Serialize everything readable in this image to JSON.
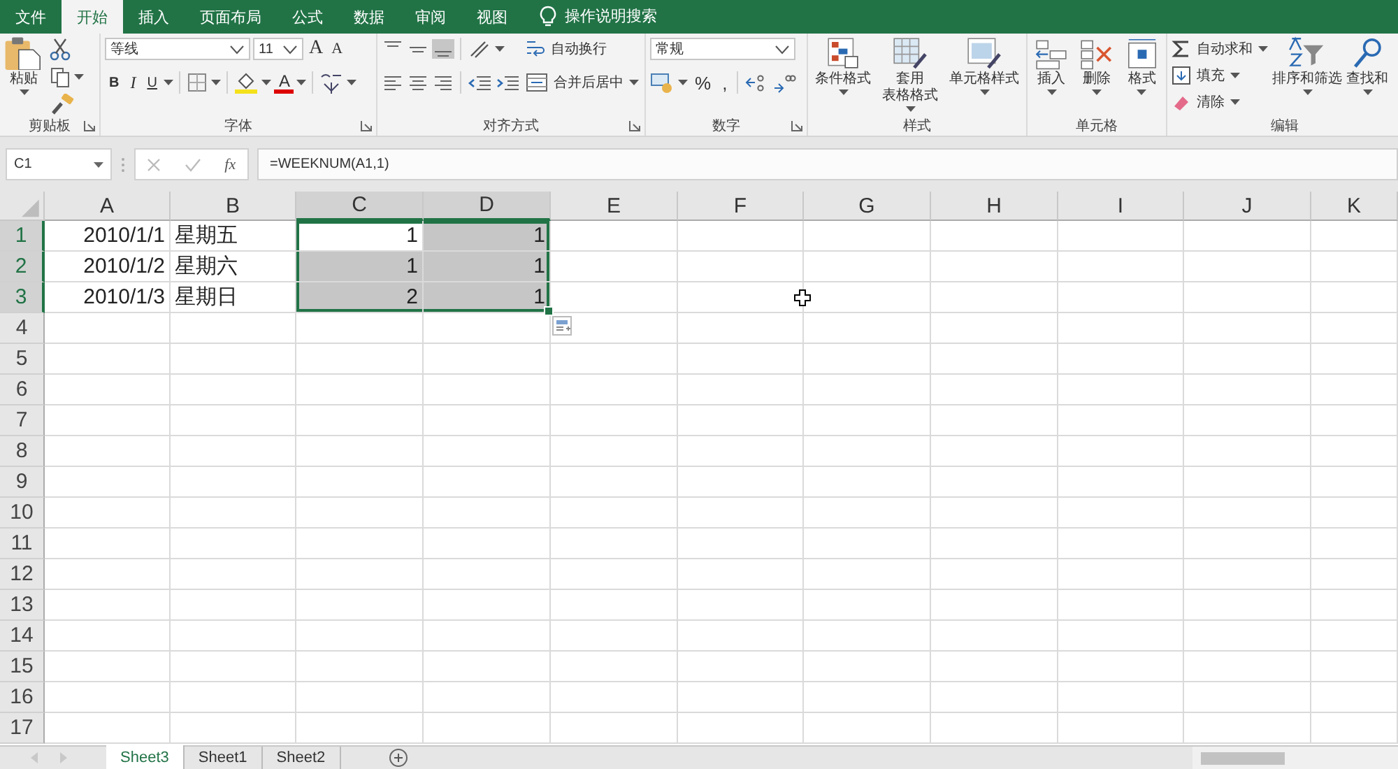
{
  "menu_tabs": [
    {
      "label": "文件",
      "selected": false
    },
    {
      "label": "开始",
      "selected": true
    },
    {
      "label": "插入",
      "selected": false
    },
    {
      "label": "页面布局",
      "selected": false
    },
    {
      "label": "公式",
      "selected": false
    },
    {
      "label": "数据",
      "selected": false
    },
    {
      "label": "审阅",
      "selected": false
    },
    {
      "label": "视图",
      "selected": false
    }
  ],
  "tell_me": {
    "placeholder": "操作说明搜索"
  },
  "ribbon_groups": [
    {
      "label": "剪贴板",
      "launcher": true,
      "items": [
        {
          "kind": "large",
          "label": "粘贴",
          "caret": true
        },
        {
          "kind": "stack",
          "rows": [
            {
              "controls": [
                {
                  "kind": "icon"
                }
              ]
            },
            {
              "controls": [
                {
                  "kind": "icon"
                },
                {
                  "kind": "caret"
                }
              ]
            },
            {
              "controls": [
                {
                  "kind": "icon"
                }
              ]
            }
          ]
        }
      ]
    },
    {
      "label": "字体",
      "launcher": true,
      "items": [
        {
          "kind": "stack",
          "rows": [
            {
              "controls": [
                {
                  "kind": "dropdown",
                  "value": "等线"
                },
                {
                  "kind": "dropdown",
                  "value": "11"
                },
                {
                  "kind": "char",
                  "text": "A"
                },
                {
                  "kind": "char",
                  "text": "A"
                }
              ]
            },
            {
              "controls": [
                {
                  "kind": "char",
                  "text": "B"
                },
                {
                  "kind": "char",
                  "text": "I"
                },
                {
                  "kind": "char",
                  "text": "U"
                },
                {
                  "kind": "caret"
                },
                {
                  "kind": "sep"
                },
                {
                  "kind": "icon"
                },
                {
                  "kind": "caret"
                },
                {
                  "kind": "sep"
                },
                {
                  "kind": "icon"
                },
                {
                  "kind": "caret"
                },
                {
                  "kind": "char",
                  "text": "A"
                },
                {
                  "kind": "caret"
                },
                {
                  "kind": "sep"
                },
                {
                  "kind": "icon"
                },
                {
                  "kind": "caret"
                }
              ]
            }
          ]
        }
      ]
    },
    {
      "label": "对齐方式",
      "launcher": true,
      "items": [
        {
          "kind": "stack",
          "rows": [
            {
              "controls": [
                {
                  "kind": "icon",
                  "pressed": false
                },
                {
                  "kind": "icon",
                  "pressed": false
                },
                {
                  "kind": "icon",
                  "pressed": true
                },
                {
                  "kind": "sep"
                },
                {
                  "kind": "icon",
                  "pressed": false
                },
                {
                  "kind": "caret"
                }
              ]
            },
            {
              "controls": [
                {
                  "kind": "icon",
                  "pressed": false
                },
                {
                  "kind": "icon",
                  "pressed": false
                },
                {
                  "kind": "icon",
                  "pressed": false
                },
                {
                  "kind": "sep"
                },
                {
                  "kind": "icon",
                  "pressed": false
                },
                {
                  "kind": "icon",
                  "pressed": false
                }
              ]
            }
          ]
        },
        {
          "kind": "stack",
          "rows": [
            {
              "controls": [
                {
                  "kind": "small",
                  "label": "自动换行",
                  "caret": false
                }
              ]
            },
            {
              "controls": [
                {
                  "kind": "small",
                  "label": "合并后居中",
                  "caret": true
                }
              ]
            }
          ]
        }
      ]
    },
    {
      "label": "数字",
      "launcher": true,
      "items": [
        {
          "kind": "stack",
          "rows": [
            {
              "controls": [
                {
                  "kind": "dropdown",
                  "value": "常规"
                }
              ]
            },
            {
              "controls": [
                {
                  "kind": "icon"
                },
                {
                  "kind": "caret"
                },
                {
                  "kind": "char",
                  "text": "%"
                },
                {
                  "kind": "char",
                  "text": ","
                },
                {
                  "kind": "sep"
                },
                {
                  "kind": "icon"
                },
                {
                  "kind": "icon"
                }
              ]
            }
          ]
        }
      ]
    },
    {
      "label": "样式",
      "launcher": false,
      "items": [
        {
          "kind": "large",
          "label": "条件格式",
          "caret": true
        },
        {
          "kind": "large",
          "lines": [
            "套用",
            "表格格式"
          ],
          "caret": true
        },
        {
          "kind": "large",
          "label": "单元格样式",
          "caret": true
        }
      ]
    },
    {
      "label": "单元格",
      "launcher": false,
      "items": [
        {
          "kind": "large",
          "label": "插入",
          "caret": true
        },
        {
          "kind": "large",
          "label": "删除",
          "caret": true
        },
        {
          "kind": "large",
          "label": "格式",
          "caret": true
        }
      ]
    },
    {
      "label": "编辑",
      "launcher": false,
      "items": [
        {
          "kind": "stack",
          "rows": [
            {
              "controls": [
                {
                  "kind": "small",
                  "label": "自动求和",
                  "caret": true
                }
              ]
            },
            {
              "controls": [
                {
                  "kind": "small",
                  "label": "填充",
                  "caret": true
                }
              ]
            },
            {
              "controls": [
                {
                  "kind": "small",
                  "label": "清除",
                  "caret": true
                }
              ]
            }
          ]
        },
        {
          "kind": "large",
          "label": "排序和筛选",
          "caret": true
        },
        {
          "kind": "large",
          "label": "查找和",
          "caret": true
        }
      ]
    }
  ],
  "name_box": {
    "value": "C1"
  },
  "function_label": "fx",
  "formula": {
    "value": "=WEEKNUM(A1,1)"
  },
  "columns": [
    {
      "label": "A",
      "selected": false
    },
    {
      "label": "B",
      "selected": false
    },
    {
      "label": "C",
      "selected": true
    },
    {
      "label": "D",
      "selected": true
    },
    {
      "label": "E",
      "selected": false
    },
    {
      "label": "F",
      "selected": false
    },
    {
      "label": "G",
      "selected": false
    },
    {
      "label": "H",
      "selected": false
    },
    {
      "label": "I",
      "selected": false
    },
    {
      "label": "J",
      "selected": false
    },
    {
      "label": "K",
      "selected": false
    }
  ],
  "rows": [
    {
      "number": "1",
      "selected": true,
      "cells": [
        {
          "text": "2010/1/1",
          "kind": "number",
          "selected": false,
          "active": false
        },
        {
          "text": "星期五",
          "kind": "text",
          "selected": false,
          "active": false
        },
        {
          "text": "1",
          "kind": "number",
          "selected": true,
          "active": true
        },
        {
          "text": "1",
          "kind": "number",
          "selected": true,
          "active": false
        }
      ]
    },
    {
      "number": "2",
      "selected": true,
      "cells": [
        {
          "text": "2010/1/2",
          "kind": "number",
          "selected": false,
          "active": false
        },
        {
          "text": "星期六",
          "kind": "text",
          "selected": false,
          "active": false
        },
        {
          "text": "1",
          "kind": "number",
          "selected": true,
          "active": false
        },
        {
          "text": "1",
          "kind": "number",
          "selected": true,
          "active": false
        }
      ]
    },
    {
      "number": "3",
      "selected": true,
      "cells": [
        {
          "text": "2010/1/3",
          "kind": "number",
          "selected": false,
          "active": false
        },
        {
          "text": "星期日",
          "kind": "text",
          "selected": false,
          "active": false
        },
        {
          "text": "2",
          "kind": "number",
          "selected": true,
          "active": false
        },
        {
          "text": "1",
          "kind": "number",
          "selected": true,
          "active": false
        }
      ]
    },
    {
      "number": "4",
      "selected": false
    },
    {
      "number": "5",
      "selected": false
    },
    {
      "number": "6",
      "selected": false
    },
    {
      "number": "7",
      "selected": false
    },
    {
      "number": "8",
      "selected": false
    },
    {
      "number": "9",
      "selected": false
    },
    {
      "number": "10",
      "selected": false
    },
    {
      "number": "11",
      "selected": false
    },
    {
      "number": "12",
      "selected": false
    },
    {
      "number": "13",
      "selected": false
    },
    {
      "number": "14",
      "selected": false
    },
    {
      "number": "15",
      "selected": false
    },
    {
      "number": "16",
      "selected": false
    },
    {
      "number": "17",
      "selected": false
    }
  ],
  "sheet_tabs": [
    {
      "label": "Sheet3",
      "selected": true
    },
    {
      "label": "Sheet1",
      "selected": false
    },
    {
      "label": "Sheet2",
      "selected": false
    }
  ]
}
